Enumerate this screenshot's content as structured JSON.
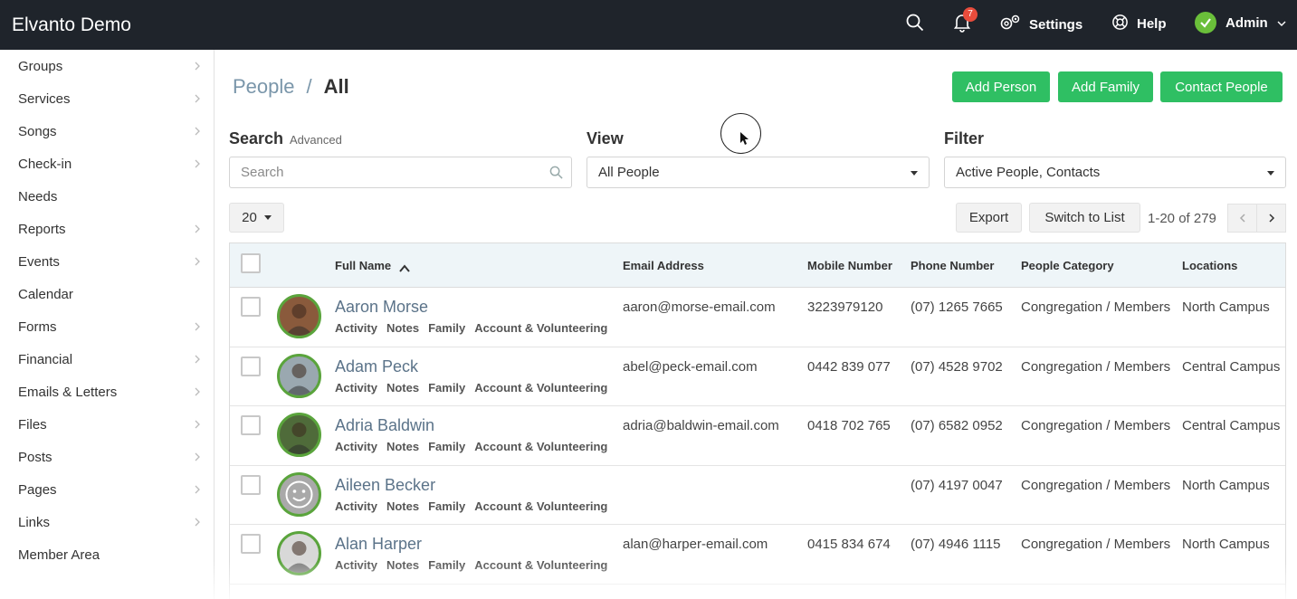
{
  "app": {
    "title": "Elvanto Demo"
  },
  "topbar": {
    "notifications_count": "7",
    "settings": "Settings",
    "help": "Help",
    "admin": "Admin"
  },
  "sidebar": {
    "items": [
      {
        "label": "Groups",
        "has_children": true
      },
      {
        "label": "Services",
        "has_children": true
      },
      {
        "label": "Songs",
        "has_children": true
      },
      {
        "label": "Check-in",
        "has_children": true
      },
      {
        "label": "Needs",
        "has_children": false
      },
      {
        "label": "Reports",
        "has_children": true
      },
      {
        "label": "Events",
        "has_children": true
      },
      {
        "label": "Calendar",
        "has_children": false
      },
      {
        "label": "Forms",
        "has_children": true
      },
      {
        "label": "Financial",
        "has_children": true
      },
      {
        "label": "Emails & Letters",
        "has_children": true
      },
      {
        "label": "Files",
        "has_children": true
      },
      {
        "label": "Posts",
        "has_children": true
      },
      {
        "label": "Pages",
        "has_children": true
      },
      {
        "label": "Links",
        "has_children": true
      },
      {
        "label": "Member Area",
        "has_children": false
      }
    ]
  },
  "breadcrumb": {
    "parent": "People",
    "separator": "/",
    "current": "All"
  },
  "actions": {
    "add_person": "Add Person",
    "add_family": "Add Family",
    "contact_people": "Contact People"
  },
  "search": {
    "label": "Search",
    "advanced": "Advanced",
    "placeholder": "Search"
  },
  "view": {
    "label": "View",
    "selected": "All People"
  },
  "filter": {
    "label": "Filter",
    "selected": "Active People, Contacts"
  },
  "toolbar": {
    "page_size": "20",
    "export": "Export",
    "switch_to_list": "Switch to List",
    "range": "1-20 of 279"
  },
  "table": {
    "columns": [
      "Full Name",
      "Email Address",
      "Mobile Number",
      "Phone Number",
      "People Category",
      "Locations"
    ],
    "row_links": [
      "Activity",
      "Notes",
      "Family",
      "Account & Volunteering"
    ],
    "rows": [
      {
        "name": "Aaron Morse",
        "email": "aaron@morse-email.com",
        "mobile": "3223979120",
        "phone": "(07) 1265 7665",
        "category": "Congregation / Members",
        "location": "North Campus",
        "avatar_color": "#8a5a3c"
      },
      {
        "name": "Adam Peck",
        "email": "abel@peck-email.com",
        "mobile": "0442 839 077",
        "phone": "(07) 4528 9702",
        "category": "Congregation / Members",
        "location": "Central Campus",
        "avatar_color": "#9aa8b0"
      },
      {
        "name": "Adria Baldwin",
        "email": "adria@baldwin-email.com",
        "mobile": "0418 702 765",
        "phone": "(07) 6582 0952",
        "category": "Congregation / Members",
        "location": "Central Campus",
        "avatar_color": "#4f6b3a"
      },
      {
        "name": "Aileen Becker",
        "email": "",
        "mobile": "",
        "phone": "(07) 4197 0047",
        "category": "Congregation / Members",
        "location": "North Campus",
        "avatar_color": "#a9a9a9"
      },
      {
        "name": "Alan Harper",
        "email": "alan@harper-email.com",
        "mobile": "0415 834 674",
        "phone": "(07) 4946 1115",
        "category": "Congregation / Members",
        "location": "North Campus",
        "avatar_color": "#d8d8d8"
      }
    ]
  }
}
